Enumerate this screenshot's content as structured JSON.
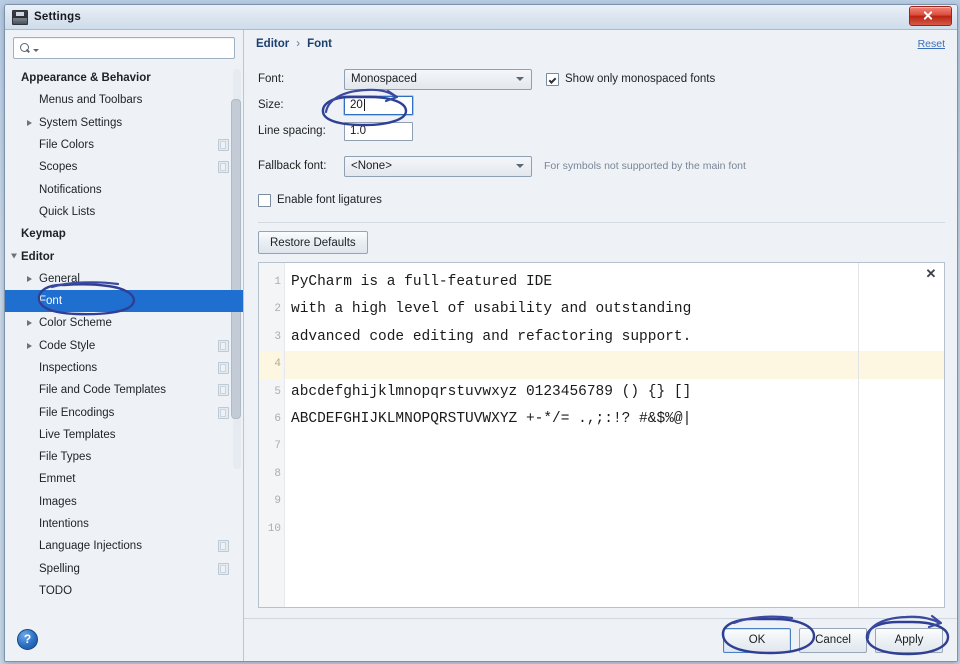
{
  "window": {
    "title": "Settings",
    "icon": "floppy-disk-icon",
    "close_label": "✕"
  },
  "search": {
    "value": "",
    "placeholder": "",
    "icon": "search-icon"
  },
  "sidebar": {
    "items": [
      {
        "label": "Appearance & Behavior",
        "level": 0,
        "bold": true,
        "arrow": "none",
        "selected": false,
        "badge": false
      },
      {
        "label": "Menus and Toolbars",
        "level": 1,
        "bold": false,
        "arrow": "none",
        "selected": false,
        "badge": false
      },
      {
        "label": "System Settings",
        "level": 1,
        "bold": false,
        "arrow": "right",
        "selected": false,
        "badge": false
      },
      {
        "label": "File Colors",
        "level": 1,
        "bold": false,
        "arrow": "none",
        "selected": false,
        "badge": true
      },
      {
        "label": "Scopes",
        "level": 1,
        "bold": false,
        "arrow": "none",
        "selected": false,
        "badge": true
      },
      {
        "label": "Notifications",
        "level": 1,
        "bold": false,
        "arrow": "none",
        "selected": false,
        "badge": false
      },
      {
        "label": "Quick Lists",
        "level": 1,
        "bold": false,
        "arrow": "none",
        "selected": false,
        "badge": false
      },
      {
        "label": "Keymap",
        "level": 0,
        "bold": true,
        "arrow": "none",
        "selected": false,
        "badge": false
      },
      {
        "label": "Editor",
        "level": 0,
        "bold": true,
        "arrow": "down",
        "selected": false,
        "badge": false
      },
      {
        "label": "General",
        "level": 1,
        "bold": false,
        "arrow": "right",
        "selected": false,
        "badge": false
      },
      {
        "label": "Font",
        "level": 1,
        "bold": false,
        "arrow": "none",
        "selected": true,
        "badge": false
      },
      {
        "label": "Color Scheme",
        "level": 1,
        "bold": false,
        "arrow": "right",
        "selected": false,
        "badge": false
      },
      {
        "label": "Code Style",
        "level": 1,
        "bold": false,
        "arrow": "right",
        "selected": false,
        "badge": true
      },
      {
        "label": "Inspections",
        "level": 1,
        "bold": false,
        "arrow": "none",
        "selected": false,
        "badge": true
      },
      {
        "label": "File and Code Templates",
        "level": 1,
        "bold": false,
        "arrow": "none",
        "selected": false,
        "badge": true
      },
      {
        "label": "File Encodings",
        "level": 1,
        "bold": false,
        "arrow": "none",
        "selected": false,
        "badge": true
      },
      {
        "label": "Live Templates",
        "level": 1,
        "bold": false,
        "arrow": "none",
        "selected": false,
        "badge": false
      },
      {
        "label": "File Types",
        "level": 1,
        "bold": false,
        "arrow": "none",
        "selected": false,
        "badge": false
      },
      {
        "label": "Emmet",
        "level": 1,
        "bold": false,
        "arrow": "none",
        "selected": false,
        "badge": false
      },
      {
        "label": "Images",
        "level": 1,
        "bold": false,
        "arrow": "none",
        "selected": false,
        "badge": false
      },
      {
        "label": "Intentions",
        "level": 1,
        "bold": false,
        "arrow": "none",
        "selected": false,
        "badge": false
      },
      {
        "label": "Language Injections",
        "level": 1,
        "bold": false,
        "arrow": "none",
        "selected": false,
        "badge": true
      },
      {
        "label": "Spelling",
        "level": 1,
        "bold": false,
        "arrow": "none",
        "selected": false,
        "badge": true
      },
      {
        "label": "TODO",
        "level": 1,
        "bold": false,
        "arrow": "none",
        "selected": false,
        "badge": false
      }
    ]
  },
  "help": {
    "label": "?"
  },
  "breadcrumb": {
    "root": "Editor",
    "separator": "›",
    "leaf": "Font",
    "reset_label": "Reset"
  },
  "font_settings": {
    "font_label": "Font:",
    "font_value": "Monospaced",
    "monospaced_only_label": "Show only monospaced fonts",
    "monospaced_only_checked": true,
    "size_label": "Size:",
    "size_value": "20",
    "line_spacing_label": "Line spacing:",
    "line_spacing_value": "1.0",
    "fallback_label": "Fallback font:",
    "fallback_value": "<None>",
    "fallback_hint": "For symbols not supported by the main font",
    "ligatures_label": "Enable font ligatures",
    "ligatures_checked": false,
    "restore_defaults_label": "Restore Defaults"
  },
  "preview": {
    "close_label": "✕",
    "line_numbers": [
      "1",
      "2",
      "3",
      "4",
      "5",
      "6",
      "7",
      "8",
      "9",
      "10"
    ],
    "highlighted_line": 4,
    "lines": [
      "PyCharm is a full-featured IDE",
      "with a high level of usability and outstanding",
      "advanced code editing and refactoring support.",
      "",
      "abcdefghijklmnopqrstuvwxyz 0123456789 () {} []",
      "ABCDEFGHIJKLMNOPQRSTUVWXYZ +-*/= .,;:!? #&$%@|",
      "",
      "",
      "",
      ""
    ]
  },
  "footer": {
    "ok_label": "OK",
    "cancel_label": "Cancel",
    "apply_label": "Apply"
  },
  "annotations": {
    "color": "#2f3f93",
    "marks": [
      "ellipse-around-font-sidebar-item",
      "ellipse-and-arrow-around-size-field",
      "ellipse-around-ok-button",
      "ellipse-and-arrow-around-apply-button"
    ]
  }
}
